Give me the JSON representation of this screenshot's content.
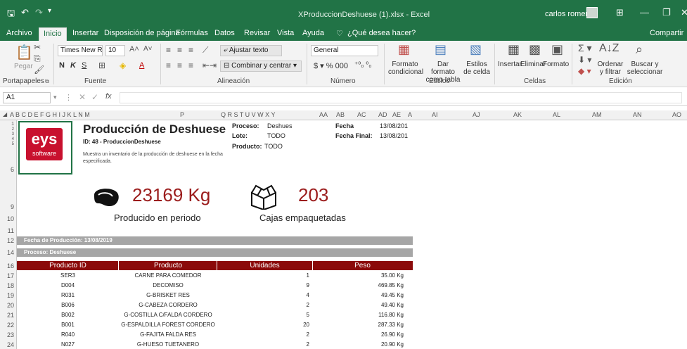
{
  "window": {
    "title": "XProduccionDeshuese (1).xlsx - Excel",
    "user": "carlos romero"
  },
  "tabs": [
    "Archivo",
    "Inicio",
    "Insertar",
    "Disposición de página",
    "Fórmulas",
    "Datos",
    "Revisar",
    "Vista",
    "Ayuda"
  ],
  "tell_me": "¿Qué desea hacer?",
  "share": "Compartir",
  "ribbon": {
    "paste": "Pegar",
    "font_name": "Times New Roma",
    "font_size": "10",
    "wrap_text": "Ajustar texto",
    "merge_center": "Combinar y centrar",
    "number_format": "General",
    "cond_format": "Formato condicional",
    "format_table": "Dar formato como tabla",
    "cell_styles": "Estilos de celda",
    "insert": "Insertar",
    "delete": "Eliminar",
    "format": "Formato",
    "sort_filter": "Ordenar y filtrar",
    "find_select": "Buscar y seleccionar",
    "groups": {
      "clipboard": "Portapapeles",
      "font": "Fuente",
      "alignment": "Alineación",
      "number": "Número",
      "styles": "Estilos",
      "cells": "Celdas",
      "editing": "Edición"
    }
  },
  "name_box": "A1",
  "columns_left": "A  B  C D  E  F G H I   J   K L  N M",
  "col_P": "P",
  "columns_mid": "Q R  S    T    U  V W X  Y",
  "col_labels_right": [
    "AA",
    "AB",
    "AC",
    "AD",
    "AE",
    "A",
    "AI",
    "AJ",
    "AK",
    "AL",
    "AM",
    "AN",
    "AO"
  ],
  "rows": [
    "1",
    "2",
    "3",
    "4",
    "5",
    "6",
    "9",
    "10",
    "11",
    "12",
    "14",
    "16",
    "17",
    "18",
    "19",
    "20",
    "21",
    "22",
    "23",
    "24"
  ],
  "logo": {
    "text": "eys",
    "sub": "software"
  },
  "report": {
    "title": "Producción de Deshuese",
    "id_line": "ID: 48 - ProduccionDeshuese",
    "description": "Muestra un inventario de la producción de deshuese en la fecha especificada.",
    "proceso_label": "Proceso:",
    "proceso_value": "Deshues",
    "lote_label": "Lote:",
    "lote_value": "TODO",
    "producto_label": "Producto:",
    "producto_value": "TODO",
    "fecha_label": "Fecha",
    "fecha_value": "13/08/201",
    "fecha_final_label": "Fecha Final:",
    "fecha_final_value": "13/08/201",
    "kpi_kg": "23169 Kg",
    "kpi_kg_label": "Producido en periodo",
    "kpi_boxes": "203",
    "kpi_boxes_label": "Cajas empaquetadas",
    "fecha_produccion": "Fecha de Producción: 13/08/2019",
    "proceso_bar": "Proceso: Deshuese"
  },
  "table": {
    "headers": [
      "Producto ID",
      "Producto",
      "Unidades",
      "Peso"
    ],
    "rows": [
      [
        "SER3",
        "CARNE PARA COMEDOR",
        "1",
        "35.00 Kg"
      ],
      [
        "D004",
        "DECOMISO",
        "9",
        "469.85 Kg"
      ],
      [
        "R031",
        "G-BRISKET RES",
        "4",
        "49.45 Kg"
      ],
      [
        "B006",
        "G-CABEZA CORDERO",
        "2",
        "49.40 Kg"
      ],
      [
        "B002",
        "G-COSTILLA C/FALDA CORDERO",
        "5",
        "116.80 Kg"
      ],
      [
        "B001",
        "G-ESPALDILLA FOREST CORDERO",
        "20",
        "287.33 Kg"
      ],
      [
        "R040",
        "G-FAJITA FALDA RES",
        "2",
        "26.90 Kg"
      ],
      [
        "N027",
        "G-HUESO TUETANERO",
        "2",
        "20.90 Kg"
      ]
    ]
  },
  "colors": {
    "excel_green": "#217346",
    "header_red": "#8b0a0a",
    "gray_bar": "#a6a6a6",
    "kpi_red": "#9b1c1c"
  }
}
